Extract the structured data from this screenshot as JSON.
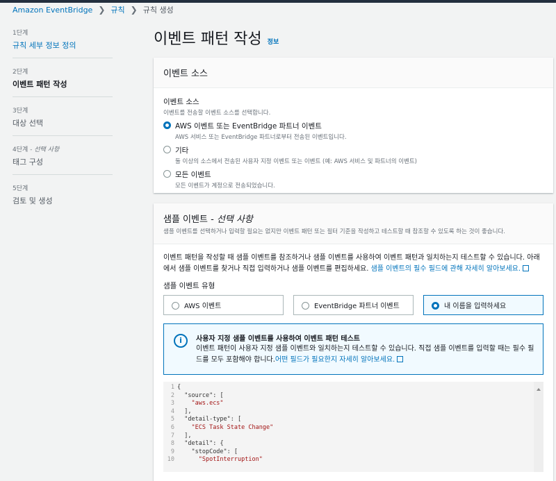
{
  "breadcrumb": [
    "Amazon EventBridge",
    "규칙",
    "규칙 생성"
  ],
  "steps": [
    {
      "num": "1단계",
      "label": "규칙 세부 정보 정의"
    },
    {
      "num": "2단계",
      "label": "이벤트 패턴 작성"
    },
    {
      "num": "3단계",
      "label": "대상 선택"
    },
    {
      "num": "4단계",
      "optional": " - 선택 사항",
      "label": "태그 구성"
    },
    {
      "num": "5단계",
      "label": "검토 및 생성"
    }
  ],
  "page_title": "이벤트 패턴 작성",
  "info_link": "정보",
  "event_source": {
    "header": "이벤트 소스",
    "label": "이벤트 소스",
    "description": "이벤트를 전송할 이벤트 소스를 선택합니다.",
    "options": [
      {
        "label": "AWS 이벤트 또는 EventBridge 파트너 이벤트",
        "desc": "AWS 서비스 또는 EventBridge 파트너로부터 전송된 이벤트입니다.",
        "selected": true
      },
      {
        "label": "기타",
        "desc": "둘 이상의 소스에서 전송된 사용자 지정 이벤트 또는 이벤트 (예: AWS 서비스 및 파트너의 이벤트)",
        "selected": false
      },
      {
        "label": "모든 이벤트",
        "desc": "모든 이벤트가 계정으로 전송되었습니다.",
        "selected": false
      }
    ]
  },
  "sample": {
    "header": "샘플 이벤트 - ",
    "header_optional": "선택 사항",
    "header_desc": "샘플 이벤트를 선택하거나 입력할 필요는 없지만 이벤트 패턴 또는 필터 기준을 작성하고 테스트할 때 참조할 수 있도록 하는 것이 좋습니다.",
    "intro": "이벤트 패턴을 작성할 때 샘플 이벤트를 참조하거나 샘플 이벤트를 사용하여 이벤트 패턴과 일치하는지 테스트할 수 있습니다. 아래에서 샘플 이벤트를 찾거나 직접 입력하거나 샘플 이벤트를 편집하세요. ",
    "intro_link": "샘플 이벤트의 필수 필드에 관해 자세히 알아보세요.",
    "type_label": "샘플 이벤트 유형",
    "types": [
      {
        "label": "AWS 이벤트",
        "selected": false
      },
      {
        "label": "EventBridge 파트너 이벤트",
        "selected": false
      },
      {
        "label": "내 이름을 입력하세요",
        "selected": true
      }
    ],
    "alert": {
      "title": "사용자 지정 샘플 이벤트를 사용하여 이벤트 패턴 테스트",
      "body": "이벤트 패턴이 사용자 지정 샘플 이벤트와 일치하는지 테스트할 수 있습니다. 직접 샘플 이벤트를 입력할 때는 필수 필드를 모두 포함해야 합니다.",
      "link": "어떤 필드가 필요한지 자세히 알아보세요."
    },
    "code_lines": [
      [
        [
          "p",
          "{"
        ]
      ],
      [
        [
          "p",
          "  "
        ],
        [
          "k",
          "\"source\""
        ],
        [
          "p",
          ": ["
        ]
      ],
      [
        [
          "p",
          "    "
        ],
        [
          "s",
          "\"aws.ecs\""
        ]
      ],
      [
        [
          "p",
          "  ],"
        ]
      ],
      [
        [
          "p",
          "  "
        ],
        [
          "k",
          "\"detail-type\""
        ],
        [
          "p",
          ": ["
        ]
      ],
      [
        [
          "p",
          "    "
        ],
        [
          "s",
          "\"ECS Task State Change\""
        ]
      ],
      [
        [
          "p",
          "  ],"
        ]
      ],
      [
        [
          "p",
          "  "
        ],
        [
          "k",
          "\"detail\""
        ],
        [
          "p",
          ": {"
        ]
      ],
      [
        [
          "p",
          "    "
        ],
        [
          "k",
          "\"stopCode\""
        ],
        [
          "p",
          ": ["
        ]
      ],
      [
        [
          "p",
          "      "
        ],
        [
          "s",
          "\"SpotInterruption\""
        ]
      ]
    ]
  }
}
